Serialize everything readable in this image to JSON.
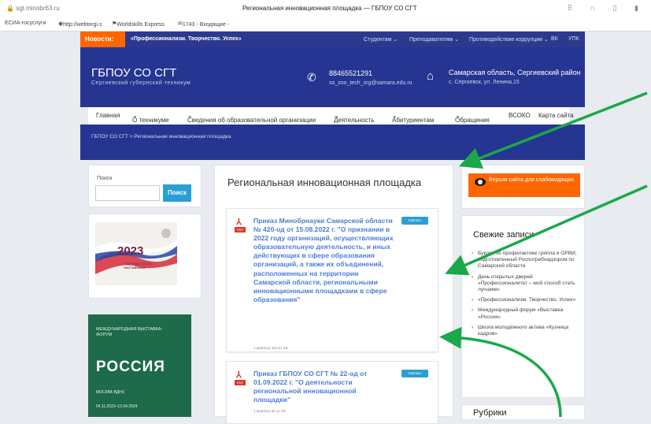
{
  "browser": {
    "url": "sgt.minobr63.ru",
    "tab_title": "Региональная инновационная площадка — ГБПОУ СО СГТ",
    "bookmarks": [
      "ЕСИА-госуслуги",
      "http://webtorgi.s",
      "Worldskills Express",
      "1743 - Входящие -"
    ]
  },
  "newsbar": {
    "label": "Новости:",
    "ticker": "«Профессионализм. Творчество. Успех»",
    "links": [
      "Студентам",
      "Преподавателям",
      "Противодействие коррупции",
      "ВК",
      "УПК"
    ]
  },
  "header": {
    "title": "ГБПОУ СО СГТ",
    "subtitle": "Сергиевский губернский техникум",
    "phone": "88465521291",
    "email": "so_zoo_tech_srg@samara.edu.ru",
    "region": "Самарская область, Сергиевский район",
    "address": "с. Сергиевск, ул. Ленина,15"
  },
  "menu": [
    "Главная",
    "О техникуме",
    "Сведения об образовательной организации",
    "Деятельность",
    "Абитуриентам",
    "Обращения",
    "ВСОКО",
    "Карта сайта"
  ],
  "breadcrumb": "ГБПОУ СО СГТ > Региональная инновационная площадка",
  "search": {
    "label": "Поиск",
    "button": "Поиск"
  },
  "page_title": "Региональная инновационная площадка",
  "documents": [
    {
      "title": "Приказ Минобрнауки Самарской области № 420-од от 15.08.2022 г. \"О признании в 2022 году организаций, осуществляющих образовательную деятельность, и иных действующих в сфере образования организаций, а также их объединений, расположенных на территории Самарской области, региональными инновационными площадками в сфере образования\"",
      "button": "Скачать",
      "meta": "1 файл(ы)   482.61 KB"
    },
    {
      "title": "Приказ ГБПОУ СО СГТ № 22-од от 01.09.2022 г. \"О деятельности региональной инновационной площадки\"",
      "button": "Скачать",
      "meta": "1 файл(ы)   60.11 KB"
    }
  ],
  "accessibility": {
    "label": "Версия сайта для слабовидящих"
  },
  "recent": {
    "heading": "Свежие записи",
    "items": [
      "Буклет по профилактике гриппа и ОРВИ, подготовленный Роспотребнадзором по Самарской области",
      "День открытых дверей «Профессионалитет – мой способ стать лучшим»",
      "«Профессионализм. Творчество. Успех»",
      "Международный форум «Выставка «Россия»",
      "Школа молодёжного актива «Кузница кадров»"
    ]
  },
  "rubrics_heading": "Рубрики",
  "banner_pedagog": {
    "year": "2023",
    "caption": "ГОД ПЕДАГОГА И НАСТАВНИКА"
  },
  "banner_russia": {
    "small": "МЕЖДУНАРОДНАЯ ВЫСТАВКА-ФОРУМ",
    "big": "РОССИЯ",
    "place": "МОСКВА ВДНХ",
    "dates": "04.11.2023–12.04.2024"
  },
  "colors": {
    "brand_blue": "#253591",
    "accent_orange": "#ff6600",
    "link_blue": "#4a7fd4",
    "button_blue": "#2a9fd6",
    "arrow_green": "#1aa84a"
  }
}
